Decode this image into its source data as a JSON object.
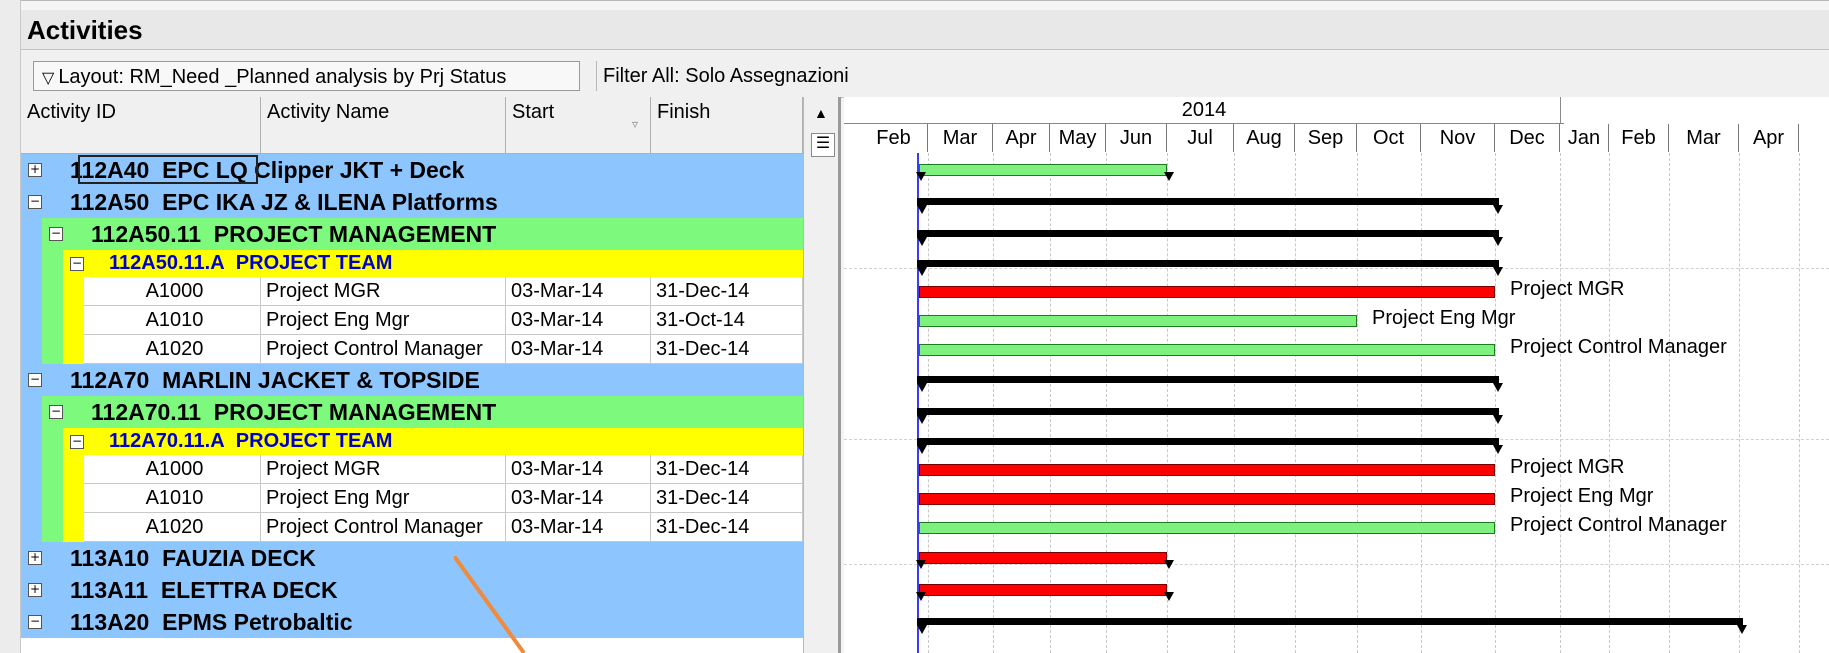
{
  "panel": {
    "title": "Activities"
  },
  "toolbar": {
    "layout_label": "Layout: RM_Need _Planned analysis by Prj Status",
    "filter_label": "Filter All: Solo Assegnazioni"
  },
  "columns": [
    "Activity ID",
    "Activity Name",
    "Start",
    "Finish"
  ],
  "timescale": {
    "year": "2014",
    "months": [
      "Feb",
      "Mar",
      "Apr",
      "May",
      "Jun",
      "Jul",
      "Aug",
      "Sep",
      "Oct",
      "Nov",
      "Dec",
      "Jan",
      "Feb",
      "Mar",
      "Apr"
    ]
  },
  "rows": [
    {
      "level": 0,
      "expander": "+",
      "type": "wbs",
      "id": "112A40",
      "name": "EPC LQ Clipper JKT + Deck",
      "bar": "green"
    },
    {
      "level": 0,
      "expander": "−",
      "type": "wbs",
      "id": "112A50",
      "name": "EPC IKA JZ & ILENA Platforms",
      "bar": "summary"
    },
    {
      "level": 1,
      "expander": "−",
      "type": "wbs",
      "id": "112A50.11",
      "name": "PROJECT MANAGEMENT",
      "bar": "summary"
    },
    {
      "level": 2,
      "expander": "−",
      "type": "wbs",
      "id": "112A50.11.A",
      "name": "PROJECT TEAM",
      "bar": "summary"
    },
    {
      "level": 3,
      "type": "activity",
      "id": "A1000",
      "name": "Project MGR",
      "start": "03-Mar-14",
      "finish": "31-Dec-14",
      "bar": "red",
      "bar_label": "Project MGR"
    },
    {
      "level": 3,
      "type": "activity",
      "id": "A1010",
      "name": "Project Eng Mgr",
      "start": "03-Mar-14",
      "finish": "31-Oct-14",
      "bar": "green",
      "bar_label": "Project Eng Mgr"
    },
    {
      "level": 3,
      "type": "activity",
      "id": "A1020",
      "name": "Project Control Manager",
      "start": "03-Mar-14",
      "finish": "31-Dec-14",
      "bar": "green",
      "bar_label": "Project Control Manager"
    },
    {
      "level": 0,
      "expander": "−",
      "type": "wbs",
      "id": "112A70",
      "name": "MARLIN JACKET & TOPSIDE",
      "bar": "summary"
    },
    {
      "level": 1,
      "expander": "−",
      "type": "wbs",
      "id": "112A70.11",
      "name": "PROJECT MANAGEMENT",
      "bar": "summary"
    },
    {
      "level": 2,
      "expander": "−",
      "type": "wbs",
      "id": "112A70.11.A",
      "name": "PROJECT TEAM",
      "bar": "summary"
    },
    {
      "level": 3,
      "type": "activity",
      "id": "A1000",
      "name": "Project MGR",
      "start": "03-Mar-14",
      "finish": "31-Dec-14",
      "bar": "red",
      "bar_label": "Project MGR"
    },
    {
      "level": 3,
      "type": "activity",
      "id": "A1010",
      "name": "Project Eng Mgr",
      "start": "03-Mar-14",
      "finish": "31-Dec-14",
      "bar": "red",
      "bar_label": "Project Eng Mgr"
    },
    {
      "level": 3,
      "type": "activity",
      "id": "A1020",
      "name": "Project Control Manager",
      "start": "03-Mar-14",
      "finish": "31-Dec-14",
      "bar": "green",
      "bar_label": "Project Control Manager"
    },
    {
      "level": 0,
      "expander": "+",
      "type": "wbs",
      "id": "113A10",
      "name": "FAUZIA DECK",
      "bar": "red"
    },
    {
      "level": 0,
      "expander": "+",
      "type": "wbs",
      "id": "113A11",
      "name": "ELETTRA DECK",
      "bar": "red"
    },
    {
      "level": 0,
      "expander": "−",
      "type": "wbs",
      "id": "113A20",
      "name": "EPMS Petrobaltic",
      "bar": "summary"
    }
  ],
  "colors": {
    "wbs_l0": "#8dc5ff",
    "wbs_l1": "#7dfa7d",
    "wbs_l2": "#ffff00",
    "wbs_l2_text": "#0000cc",
    "bar_green": "#7df07d",
    "bar_red": "#ff0000",
    "data_date": "#3a3aff",
    "annotation_arrow": "#f08a3c"
  }
}
